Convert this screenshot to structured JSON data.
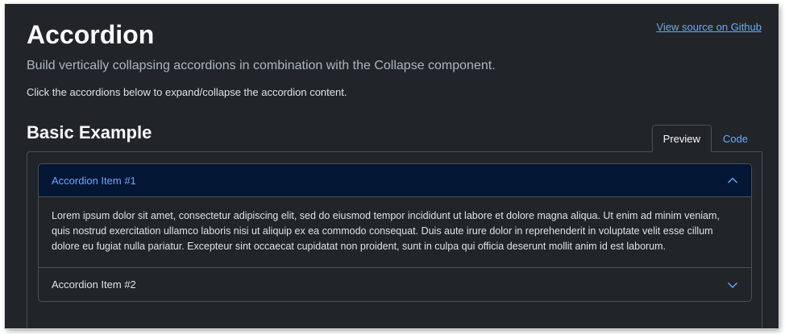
{
  "header": {
    "title": "Accordion",
    "source_link": "View source on Github",
    "lead": "Build vertically collapsing accordions in combination with the Collapse component.",
    "hint": "Click the accordions below to expand/collapse the accordion content."
  },
  "section": {
    "title": "Basic Example",
    "tabs": [
      {
        "label": "Preview",
        "active": true
      },
      {
        "label": "Code",
        "active": false
      }
    ]
  },
  "accordion": {
    "items": [
      {
        "label": "Accordion Item #1",
        "expanded": true,
        "icon": "chevron-up-icon",
        "body": "Lorem ipsum dolor sit amet, consectetur adipiscing elit, sed do eiusmod tempor incididunt ut labore et dolore magna aliqua. Ut enim ad minim veniam, quis nostrud exercitation ullamco laboris nisi ut aliquip ex ea commodo consequat. Duis aute irure dolor in reprehenderit in voluptate velit esse cillum dolore eu fugiat nulla pariatur. Excepteur sint occaecat cupidatat non proident, sunt in culpa qui officia deserunt mollit anim id est laborum."
      },
      {
        "label": "Accordion Item #2",
        "expanded": false,
        "icon": "chevron-down-icon"
      }
    ]
  },
  "colors": {
    "background": "#212529",
    "accent": "#6ea8fe",
    "active_header_bg": "#031633",
    "border": "#495057"
  }
}
